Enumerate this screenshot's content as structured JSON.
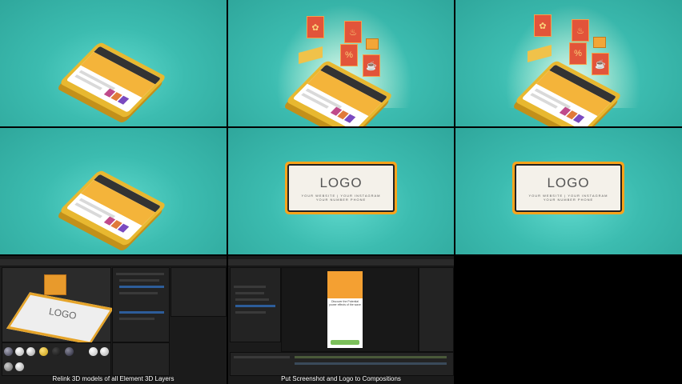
{
  "panels": {
    "logo_text": "LOGO",
    "logo_subtitle_1": "YOUR WEBSITE | YOUR INSTAGRAM",
    "logo_subtitle_2": "YOUR NUMBER PHONE"
  },
  "screen_content": {
    "heading": "Discover the Potential power effects of the wave",
    "card_label": "LOGO"
  },
  "captions": {
    "left": "Relink 3D models of all Element 3D Layers",
    "right": "Put Screenshot and Logo to Compositions"
  },
  "colors": {
    "teal": "#3cbcb0",
    "phone_gold": "#e8b830",
    "card_red": "#e2543a",
    "logo_orange": "#f9a41c",
    "editor_bg": "#1b1b1b"
  }
}
